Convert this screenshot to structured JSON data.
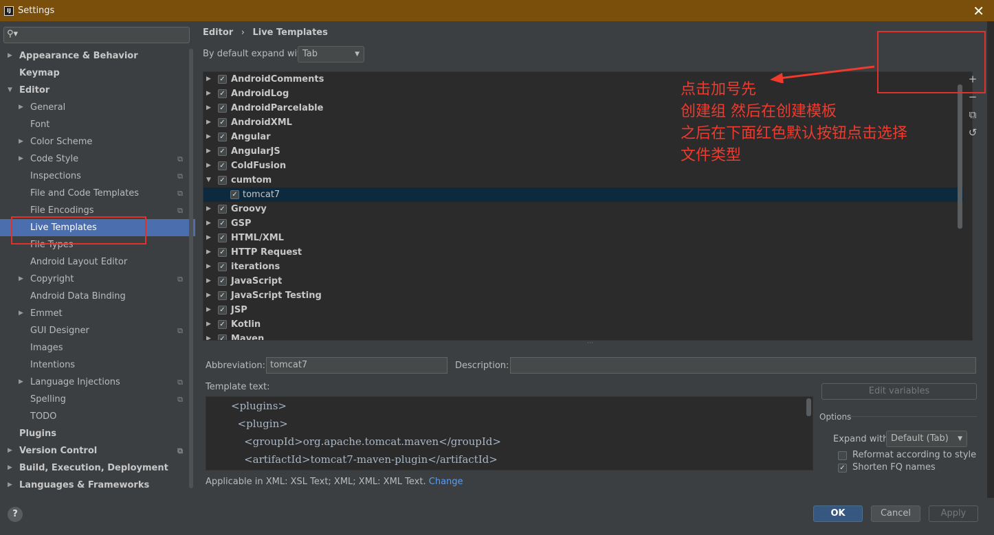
{
  "window": {
    "title": "Settings",
    "close": "✕"
  },
  "search": {
    "placeholder": ""
  },
  "sidebar": {
    "items": [
      {
        "label": "Appearance & Behavior"
      },
      {
        "label": "Keymap"
      },
      {
        "label": "Editor"
      },
      {
        "label": "General"
      },
      {
        "label": "Font"
      },
      {
        "label": "Color Scheme"
      },
      {
        "label": "Code Style"
      },
      {
        "label": "Inspections"
      },
      {
        "label": "File and Code Templates"
      },
      {
        "label": "File Encodings"
      },
      {
        "label": "Live Templates"
      },
      {
        "label": "File Types"
      },
      {
        "label": "Android Layout Editor"
      },
      {
        "label": "Copyright"
      },
      {
        "label": "Android Data Binding"
      },
      {
        "label": "Emmet"
      },
      {
        "label": "GUI Designer"
      },
      {
        "label": "Images"
      },
      {
        "label": "Intentions"
      },
      {
        "label": "Language Injections"
      },
      {
        "label": "Spelling"
      },
      {
        "label": "TODO"
      },
      {
        "label": "Plugins"
      },
      {
        "label": "Version Control"
      },
      {
        "label": "Build, Execution, Deployment"
      },
      {
        "label": "Languages & Frameworks"
      }
    ]
  },
  "breadcrumb": {
    "parent": "Editor",
    "sep": "›",
    "current": "Live Templates"
  },
  "expand": {
    "label": "By default expand with",
    "value": "Tab"
  },
  "templates": [
    {
      "name": "AndroidComments"
    },
    {
      "name": "AndroidLog"
    },
    {
      "name": "AndroidParcelable"
    },
    {
      "name": "AndroidXML"
    },
    {
      "name": "Angular"
    },
    {
      "name": "AngularJS"
    },
    {
      "name": "ColdFusion"
    },
    {
      "name": "cumtom"
    },
    {
      "name": "tomcat7"
    },
    {
      "name": "Groovy"
    },
    {
      "name": "GSP"
    },
    {
      "name": "HTML/XML"
    },
    {
      "name": "HTTP Request"
    },
    {
      "name": "iterations"
    },
    {
      "name": "JavaScript"
    },
    {
      "name": "JavaScript Testing"
    },
    {
      "name": "JSP"
    },
    {
      "name": "Kotlin"
    },
    {
      "name": "Maven"
    }
  ],
  "side_buttons": {
    "add": "+",
    "remove": "−",
    "copy": "⧉",
    "restore": "↺"
  },
  "annotation": {
    "line1": "点击加号先",
    "line2": "创建组 然后在创建模板",
    "line3": "之后在下面红色默认按钮点击选择",
    "line4": "文件类型"
  },
  "abbreviation": {
    "label": "Abbreviation:",
    "value": "tomcat7"
  },
  "description": {
    "label": "Description:",
    "value": ""
  },
  "template_text": {
    "label": "Template text:",
    "lines": [
      "<plugins>",
      "  <plugin>",
      "    <groupId>org.apache.tomcat.maven</groupId>",
      "    <artifactId>tomcat7-maven-plugin</artifactId>"
    ]
  },
  "edit_variables": "Edit variables",
  "options": {
    "title": "Options",
    "expand_label": "Expand with",
    "expand_value": "Default (Tab)",
    "reformat": "Reformat according to style",
    "shorten": "Shorten FQ names"
  },
  "applicable": {
    "text": "Applicable in XML: XSL Text; XML; XML: XML Text.",
    "link": "Change"
  },
  "footer": {
    "help": "?",
    "ok": "OK",
    "cancel": "Cancel",
    "apply": "Apply"
  },
  "colors": {
    "accent": "#4b6eaf",
    "annotation": "#f03a2e",
    "titlebar": "#7a4f0c"
  }
}
